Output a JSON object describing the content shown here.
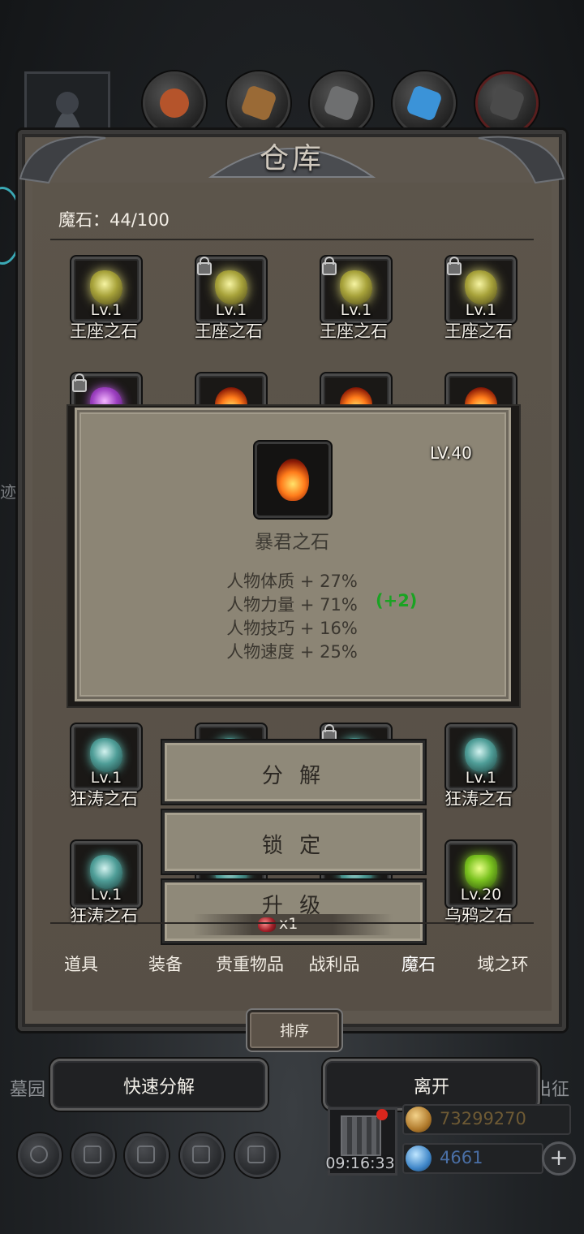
{
  "window": {
    "title": "仓库"
  },
  "inventory": {
    "label": "魔石",
    "separator": "：",
    "count": "44/100"
  },
  "items": [
    {
      "name": "王座之石",
      "level": "Lv.1",
      "type": "throne",
      "locked": false
    },
    {
      "name": "王座之石",
      "level": "Lv.1",
      "type": "throne",
      "locked": true
    },
    {
      "name": "王座之石",
      "level": "Lv.1",
      "type": "throne",
      "locked": true
    },
    {
      "name": "王座之石",
      "level": "Lv.1",
      "type": "throne",
      "locked": true
    },
    {
      "name": "",
      "level": "",
      "type": "purple",
      "locked": true
    },
    {
      "name": "",
      "level": "",
      "type": "fire",
      "locked": false
    },
    {
      "name": "",
      "level": "",
      "type": "fire",
      "locked": false
    },
    {
      "name": "",
      "level": "",
      "type": "fire",
      "locked": false
    },
    {
      "name": "狂涛之石",
      "level": "Lv.1",
      "type": "storm",
      "locked": false
    },
    {
      "name": "",
      "level": "",
      "type": "storm",
      "locked": false
    },
    {
      "name": "",
      "level": "",
      "type": "storm",
      "locked": true
    },
    {
      "name": "狂涛之石",
      "level": "Lv.1",
      "type": "storm",
      "locked": false
    },
    {
      "name": "狂涛之石",
      "level": "Lv.1",
      "type": "storm",
      "locked": false
    },
    {
      "name": "",
      "level": "",
      "type": "storm",
      "locked": false
    },
    {
      "name": "",
      "level": "",
      "type": "storm",
      "locked": false
    },
    {
      "name": "乌鸦之石",
      "level": "Lv.20",
      "type": "crow",
      "locked": false
    }
  ],
  "tooltip": {
    "level": "LV.40",
    "name": "暴君之石",
    "stats": [
      "人物体质 + 27%",
      "人物力量 + 71%",
      "人物技巧 + 16%",
      "人物速度 + 25%"
    ],
    "bonus": "(+2)"
  },
  "actions": {
    "decompose": "分 解",
    "lock": "锁 定",
    "upgrade": "升 级",
    "upgrade_cost": "x1"
  },
  "tabs": [
    {
      "label": "道具",
      "active": false
    },
    {
      "label": "装备",
      "active": false
    },
    {
      "label": "贵重物品",
      "active": false
    },
    {
      "label": "战利品",
      "active": false
    },
    {
      "label": "魔石",
      "active": true
    },
    {
      "label": "域之环",
      "active": false
    }
  ],
  "sort_label": "排序",
  "quick_decompose_label": "快速分解",
  "leave_label": "离开",
  "side_left": "墓园",
  "side_right": "出征",
  "side_partial": "迹",
  "timer": "09:16:33",
  "gold": "73299270",
  "gems": "4661",
  "plus_label": "+",
  "colors": {
    "gold_text": "#6e5a34",
    "gem_text": "#4a6fa6",
    "bonus_green": "#1aa323"
  },
  "icons": [
    "avatar-icon",
    "ore-icon",
    "wood-icon",
    "iron-icon",
    "crystal-icon",
    "dark-iron-icon",
    "settings-icon",
    "star-icon",
    "helmet-icon",
    "mail-icon",
    "gift-icon",
    "gold-coin-icon",
    "blue-gem-icon"
  ]
}
